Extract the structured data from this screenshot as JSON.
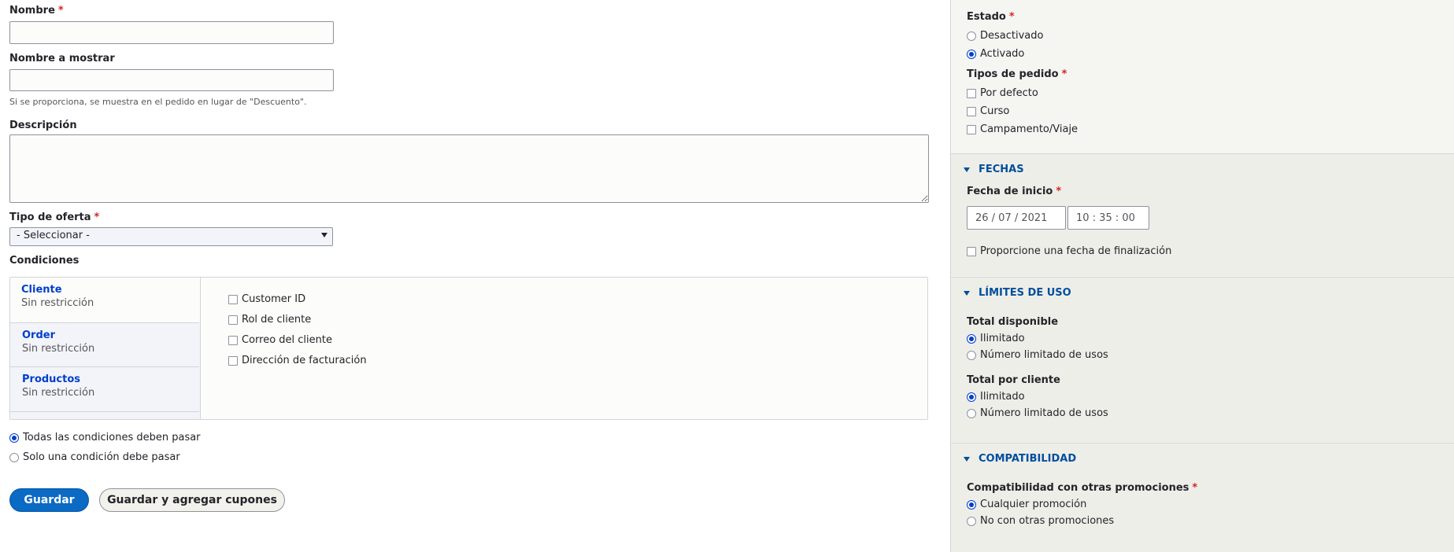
{
  "form": {
    "name_label": "Nombre",
    "required_mark": "*",
    "name_value": "",
    "display_name_label": "Nombre a mostrar",
    "display_name_value": "",
    "display_name_hint": "Si se proporciona, se muestra en el pedido en lugar de \"Descuento\".",
    "description_label": "Descripción",
    "description_value": "",
    "offer_type_label": "Tipo de oferta",
    "offer_type_selected": "- Seleccionar -",
    "conditions_label": "Condiciones"
  },
  "conditions": {
    "tabs": [
      {
        "title": "Cliente",
        "summary": "Sin restricción"
      },
      {
        "title": "Order",
        "summary": "Sin restricción"
      },
      {
        "title": "Productos",
        "summary": "Sin restricción"
      }
    ],
    "options": [
      "Customer ID",
      "Rol de cliente",
      "Correo del cliente",
      "Dirección de facturación"
    ],
    "operator_options": [
      "Todas las condiciones deben pasar",
      "Solo una condición debe pasar"
    ],
    "operator_selected": 0
  },
  "actions": {
    "save_label": "Guardar",
    "save_add_coupons_label": "Guardar y agregar cupones"
  },
  "sidebar": {
    "status_label": "Estado",
    "status_options": [
      "Desactivado",
      "Activado"
    ],
    "status_selected": 1,
    "order_types_label": "Tipos de pedido",
    "order_types": [
      "Por defecto",
      "Curso",
      "Campamento/Viaje"
    ],
    "dates": {
      "section_label": "FECHAS",
      "start_date_label": "Fecha de inicio",
      "date_value": "26 / 07 / 2021",
      "time_value": "10 : 35 : 00",
      "end_date_checkbox": "Proporcione una fecha de finalización"
    },
    "usage": {
      "section_label": "LÍMITES DE USO",
      "total_label": "Total disponible",
      "total_options": [
        "Ilimitado",
        "Número limitado de usos"
      ],
      "total_selected": 0,
      "per_customer_label": "Total por cliente",
      "per_customer_options": [
        "Ilimitado",
        "Número limitado de usos"
      ],
      "per_customer_selected": 0
    },
    "compat": {
      "section_label": "COMPATIBILIDAD",
      "label": "Compatibilidad con otras promociones",
      "options": [
        "Cualquier promoción",
        "No con otras promociones"
      ],
      "selected": 0
    }
  },
  "colors": {
    "accent": "#003ecc",
    "link": "#004f9e",
    "required": "#dc2323",
    "primary_button": "#0a6ac4"
  }
}
